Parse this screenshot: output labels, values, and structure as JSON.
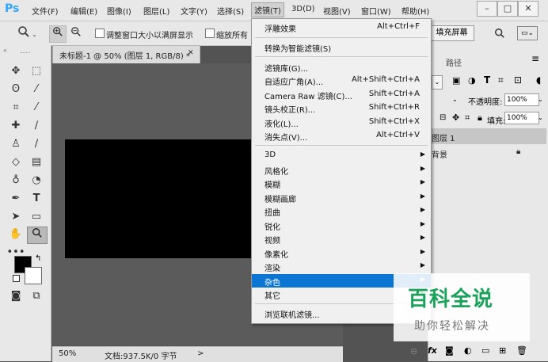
{
  "menubar": {
    "logo": "Ps",
    "items": [
      "文件(F)",
      "编辑(E)",
      "图像(I)",
      "图层(L)",
      "文字(Y)",
      "选择(S)",
      "滤镜(T)",
      "3D(D)",
      "视图(V)",
      "窗口(W)",
      "帮助(H)"
    ],
    "window_buttons": [
      "–",
      "□",
      "✕"
    ]
  },
  "optionsbar": {
    "checkbox1": "调整窗口大小以满屏显示",
    "checkbox2": "缩放所有",
    "fill_screen": "填充屏幕"
  },
  "document": {
    "tab_title": "未标题-1 @ 50% (图层 1, RGB/8) *",
    "tab_close": "✕",
    "zoom": "50%",
    "doc_info": "文档:937.5K/0 字节",
    "status_arrow": ">"
  },
  "panel": {
    "tab": "路径",
    "opacity_label": "不透明度:",
    "opacity_value": "100%",
    "fill_label": "填充:",
    "fill_value": "100%",
    "layers": [
      {
        "name": "图层 1"
      },
      {
        "name": "背景"
      }
    ]
  },
  "filter_menu": {
    "items": [
      {
        "label": "浮雕效果",
        "shortcut": "Alt+Ctrl+F"
      },
      {
        "label": "转换为智能滤镜(S)",
        "shortcut": ""
      },
      {
        "label": "滤镜库(G)...",
        "shortcut": ""
      },
      {
        "label": "自适应广角(A)...",
        "shortcut": "Alt+Shift+Ctrl+A"
      },
      {
        "label": "Camera Raw 滤镜(C)...",
        "shortcut": "Shift+Ctrl+A"
      },
      {
        "label": "镜头校正(R)...",
        "shortcut": "Shift+Ctrl+R"
      },
      {
        "label": "液化(L)...",
        "shortcut": "Shift+Ctrl+X"
      },
      {
        "label": "消失点(V)...",
        "shortcut": "Alt+Ctrl+V"
      },
      {
        "label": "3D",
        "shortcut": ""
      },
      {
        "label": "风格化",
        "shortcut": ""
      },
      {
        "label": "模糊",
        "shortcut": ""
      },
      {
        "label": "模糊画廊",
        "shortcut": ""
      },
      {
        "label": "扭曲",
        "shortcut": ""
      },
      {
        "label": "锐化",
        "shortcut": ""
      },
      {
        "label": "视频",
        "shortcut": ""
      },
      {
        "label": "像素化",
        "shortcut": ""
      },
      {
        "label": "渲染",
        "shortcut": ""
      },
      {
        "label": "杂色",
        "shortcut": ""
      },
      {
        "label": "其它",
        "shortcut": ""
      },
      {
        "label": "浏览联机滤镜...",
        "shortcut": ""
      }
    ]
  },
  "watermark": {
    "title": "百科全说",
    "subtitle": "助你轻松解决"
  },
  "colors": {
    "highlight": "#0a75d2",
    "watermark_green": "#19a35a"
  }
}
